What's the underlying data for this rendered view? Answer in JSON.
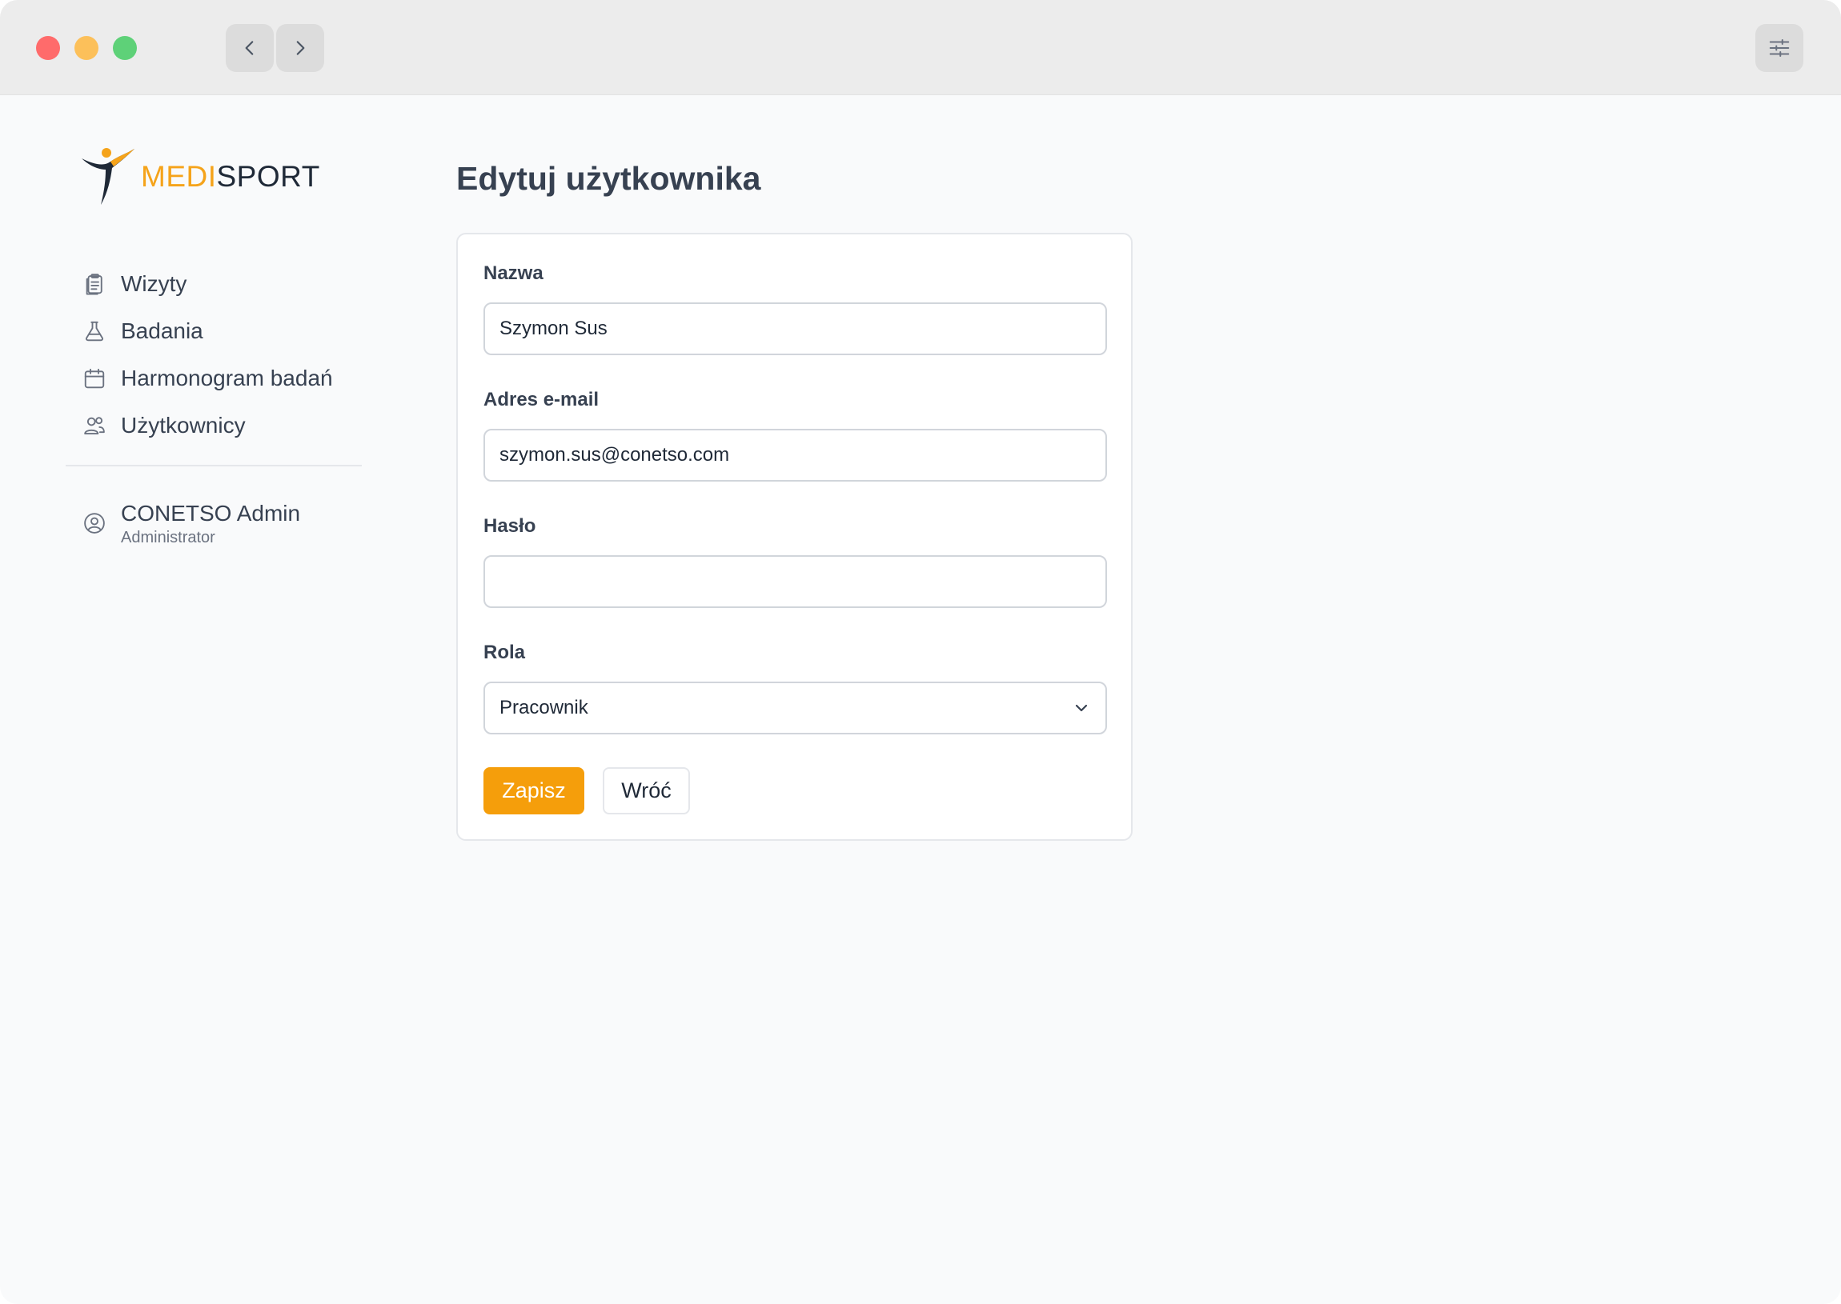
{
  "brand": {
    "part1": "MEDI",
    "part2": "SPORT",
    "accent": "#f5a31a"
  },
  "window_controls": {
    "close_color": "#ff6b6b",
    "minimize_color": "#fcc05a",
    "maximize_color": "#5ed178"
  },
  "sidebar": {
    "items": [
      {
        "label": "Wizyty",
        "icon": "clipboard-icon"
      },
      {
        "label": "Badania",
        "icon": "flask-icon"
      },
      {
        "label": "Harmonogram badań",
        "icon": "calendar-icon"
      },
      {
        "label": "Użytkownicy",
        "icon": "users-icon"
      }
    ],
    "user": {
      "name": "CONETSO Admin",
      "role": "Administrator",
      "icon": "user-circle-icon"
    }
  },
  "main": {
    "title": "Edytuj użytkownika",
    "form": {
      "name": {
        "label": "Nazwa",
        "value": "Szymon Sus"
      },
      "email": {
        "label": "Adres e-mail",
        "value": "szymon.sus@conetso.com"
      },
      "password": {
        "label": "Hasło",
        "value": ""
      },
      "role": {
        "label": "Rola",
        "value": "Pracownik"
      },
      "save_label": "Zapisz",
      "back_label": "Wróć"
    }
  }
}
